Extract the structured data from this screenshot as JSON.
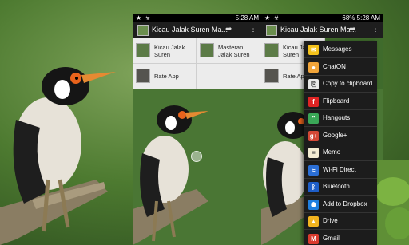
{
  "status": {
    "time_1": "5:28 AM",
    "time_2": "5:28 AM",
    "battery_pct": "68%",
    "icons_left": "★ ☣",
    "icons_right": "▣ ⏰ △ ▮"
  },
  "app": {
    "title_1": "Kicau Jalak Suren Ma...",
    "title_2": "Kicau Jalak Suren Ma..."
  },
  "grid_1": [
    {
      "label": "Kicau Jalak Suren"
    },
    {
      "label": "Masteran Jalak Suren"
    },
    {
      "label": "Rate App"
    }
  ],
  "grid_2": [
    {
      "label": "Kicau Jalak Suren"
    },
    {
      "label": "Rate App"
    }
  ],
  "share_menu": [
    {
      "label": "Messages",
      "icon": "messages-icon",
      "color": "#f4c21b"
    },
    {
      "label": "ChatON",
      "icon": "chaton-icon",
      "color": "#f2a53a"
    },
    {
      "label": "Copy to clipboard",
      "icon": "clipboard-icon",
      "color": "#e8e8e8"
    },
    {
      "label": "Flipboard",
      "icon": "flipboard-icon",
      "color": "#e02424"
    },
    {
      "label": "Hangouts",
      "icon": "hangouts-icon",
      "color": "#3aa757"
    },
    {
      "label": "Google+",
      "icon": "googleplus-icon",
      "color": "#d34836"
    },
    {
      "label": "Memo",
      "icon": "memo-icon",
      "color": "#f3ecd2"
    },
    {
      "label": "Wi-Fi Direct",
      "icon": "wifi-direct-icon",
      "color": "#2b6fd6"
    },
    {
      "label": "Bluetooth",
      "icon": "bluetooth-icon",
      "color": "#1e5ec9"
    },
    {
      "label": "Add to Dropbox",
      "icon": "dropbox-icon",
      "color": "#1f7fe0"
    },
    {
      "label": "Drive",
      "icon": "drive-icon",
      "color": "#f2b41f"
    },
    {
      "label": "Gmail",
      "icon": "gmail-icon",
      "color": "#d93b2e"
    }
  ]
}
